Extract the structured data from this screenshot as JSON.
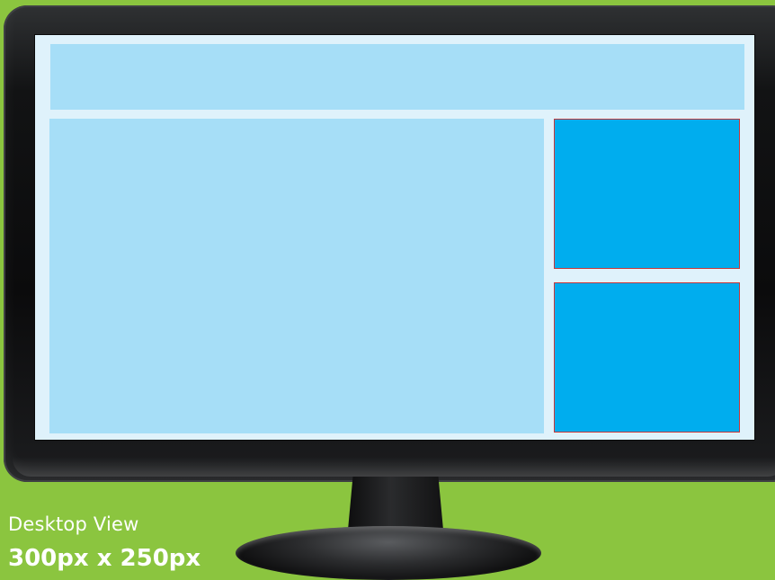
{
  "colors": {
    "background": "#8bc53f",
    "screen": "#dff2fb",
    "layout_block": "#a6def7",
    "ad_block": "#00adee",
    "ad_border": "#c6383b",
    "label_text": "#ffffff"
  },
  "caption": {
    "view_label": "Desktop View",
    "size_label": "300px x 250px"
  },
  "layout_blocks": [
    "header",
    "main-content",
    "ad-unit-top",
    "ad-unit-bottom"
  ]
}
